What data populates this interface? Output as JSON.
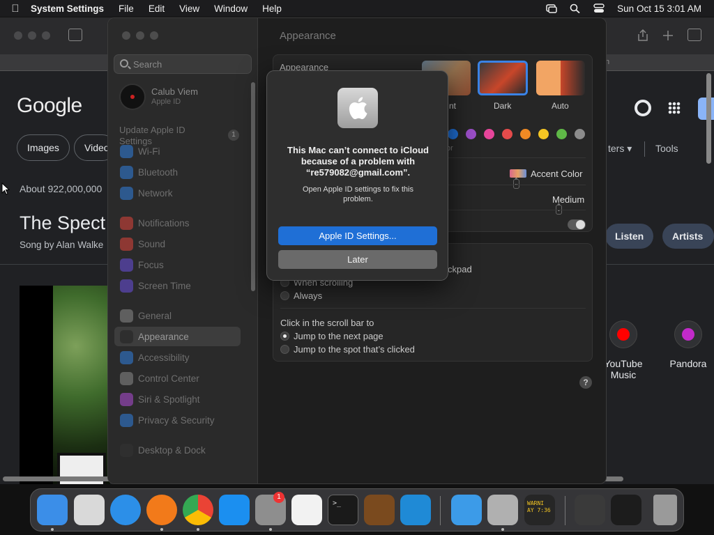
{
  "menubar": {
    "app_name": "System Settings",
    "items": [
      "File",
      "Edit",
      "View",
      "Window",
      "Help"
    ],
    "datetime": "Sun Oct 15  3:01 AM"
  },
  "browser": {
    "address_tail": "h",
    "google_logo": "Google",
    "chips": [
      "Images",
      "Video"
    ],
    "filters_tail": "ters",
    "tools": "Tools",
    "about": "About 922,000,000",
    "result_title": "The Spect",
    "result_sub": "Song by Alan Walke",
    "pills": [
      "Listen",
      "Artists"
    ],
    "apps": [
      {
        "name": "YouTube Music",
        "color": "#ff0000"
      },
      {
        "name": "Pandora",
        "color": "#c22ac9"
      }
    ]
  },
  "settings": {
    "search_placeholder": "Search",
    "account": {
      "name": "Calub Viem",
      "sub": "Apple ID"
    },
    "update": {
      "label": "Update Apple ID Settings",
      "count": "1"
    },
    "sidebar_items": [
      {
        "label": "Wi-Fi",
        "color": "#2f7fe0",
        "icon": "wifi-icon"
      },
      {
        "label": "Bluetooth",
        "color": "#2f7fe0",
        "icon": "bluetooth-icon"
      },
      {
        "label": "Network",
        "color": "#2f7fe0",
        "icon": "network-icon"
      },
      {
        "label": "Notifications",
        "color": "#e0443a",
        "icon": "bell-icon"
      },
      {
        "label": "Sound",
        "color": "#e0443a",
        "icon": "speaker-icon"
      },
      {
        "label": "Focus",
        "color": "#6a4ee0",
        "icon": "moon-icon"
      },
      {
        "label": "Screen Time",
        "color": "#6a4ee0",
        "icon": "hourglass-icon"
      },
      {
        "label": "General",
        "color": "#8a8a8a",
        "icon": "gear-icon"
      },
      {
        "label": "Appearance",
        "color": "#222222",
        "icon": "appearance-icon"
      },
      {
        "label": "Accessibility",
        "color": "#2f7fe0",
        "icon": "accessibility-icon"
      },
      {
        "label": "Control Center",
        "color": "#8a8a8a",
        "icon": "control-center-icon"
      },
      {
        "label": "Siri & Spotlight",
        "color": "#b04cd8",
        "icon": "siri-icon"
      },
      {
        "label": "Privacy & Security",
        "color": "#2f7fe0",
        "icon": "hand-icon"
      },
      {
        "label": "Desktop & Dock",
        "color": "#333333",
        "icon": "dock-icon"
      }
    ],
    "active_item": "Appearance",
    "page_title": "Appearance",
    "appearance_label": "Appearance",
    "appearance_options": [
      "nt",
      "Dark",
      "Auto"
    ],
    "accent_colors": [
      "#1f6fd6",
      "#9b4fc8",
      "#e6459a",
      "#e54b4b",
      "#f08a24",
      "#f5c623",
      "#5fb847",
      "#8c8c8c"
    ],
    "accent_tail": "or",
    "highlight_color": "Accent Color",
    "sidebar_icon_size": "Medium",
    "trackpad_tail": "ckpad",
    "scroll_options": [
      "When scrolling",
      "Always"
    ],
    "click_label": "Click in the scroll bar to",
    "click_options": [
      "Jump to the next page",
      "Jump to the spot that’s clicked"
    ],
    "help": "?"
  },
  "dialog": {
    "title": "This Mac can’t connect to iCloud because of a problem with “re579082@gmail.com”.",
    "message": "Open Apple ID settings to fix this problem.",
    "primary": "Apple ID Settings...",
    "secondary": "Later"
  },
  "dock": {
    "badge": "1",
    "apps": [
      {
        "name": "finder-icon",
        "color": "#3b8ee8"
      },
      {
        "name": "launchpad-icon",
        "color": "#d9d9d9"
      },
      {
        "name": "safari-icon",
        "color": "#2c8fe8"
      },
      {
        "name": "firefox-icon",
        "color": "#f27a1a"
      },
      {
        "name": "chrome-icon",
        "color": "#f0f0f0"
      },
      {
        "name": "app-store-icon",
        "color": "#1b8ff0"
      },
      {
        "name": "system-settings-icon",
        "color": "#8e8e8e"
      },
      {
        "name": "textedit-icon",
        "color": "#f2f2f2"
      },
      {
        "name": "terminal-icon",
        "color": "#1a1a1a"
      },
      {
        "name": "garageband-icon",
        "color": "#7a4a1e"
      },
      {
        "name": "vscode-icon",
        "color": "#1f8ad6"
      },
      {
        "name": "weather-icon",
        "color": "#3c9be8"
      },
      {
        "name": "system-settings-running-icon",
        "color": "#b0b0b0"
      },
      {
        "name": "console-icon",
        "color": "#262626"
      },
      {
        "name": "screenshot-icon",
        "color": "#3a3a3a"
      },
      {
        "name": "window-icon",
        "color": "#1c1c1c"
      },
      {
        "name": "trash-icon",
        "color": "#9a9a9a"
      }
    ],
    "console_text": "WARNI\nAY 7:36"
  }
}
